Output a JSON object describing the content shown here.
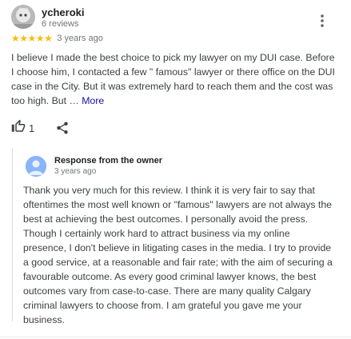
{
  "review": {
    "reviewer": {
      "name": "ycheroki",
      "meta": "6 reviews"
    },
    "rating": {
      "stars": 5,
      "max": 5,
      "star_glyph": "★",
      "star_color": "#fbbc04"
    },
    "time_ago": "3 years ago",
    "text": "I believe I made the best choice to pick my lawyer on my DUI case. Before I choose him, I contacted a few \" famous\" lawyer or there office on the DUI case in the City. But it was extremely hard to reach them and the cost was too high. But …",
    "more_label": "More",
    "actions": {
      "like_icon": "thumbs-up-icon",
      "like_count": "1",
      "share_icon": "share-icon"
    },
    "more_menu_icon": "more-vert-icon"
  },
  "owner_response": {
    "title": "Response from the owner",
    "time_ago": "3 years ago",
    "avatar_icon": "person-icon",
    "text": "Thank you very much for this review. I think it is very fair to say that oftentimes the most well known or \"famous\" lawyers are not always the best at achieving the best outcomes. I personally avoid the press. Though I certainly work hard to attract business via my online presence, I don't believe in litigating cases in the media. I try to provide a good service, at a reasonable and fair rate; with the aim of securing a favourable outcome. As every good criminal lawyer knows, the best outcomes vary from case-to-case. There are many quality Calgary criminal lawyers to choose from. I am grateful you gave me your business."
  },
  "colors": {
    "link": "#1a0dab",
    "owner_avatar": "#8ab4f8",
    "secondary_text": "#70757a"
  }
}
